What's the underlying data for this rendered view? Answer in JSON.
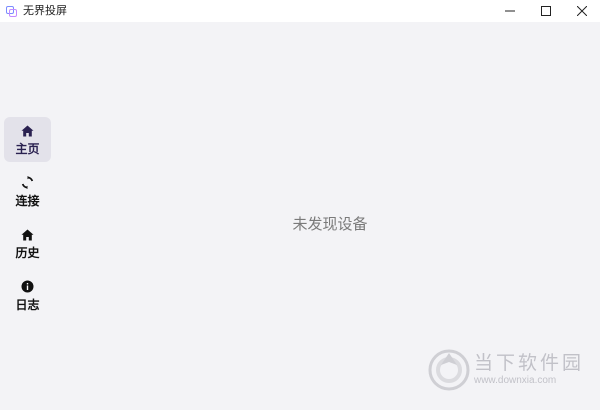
{
  "window": {
    "title": "无界投屏",
    "controls": {
      "minimize_icon": "minimize-icon",
      "maximize_icon": "maximize-icon",
      "close_icon": "close-icon"
    }
  },
  "sidebar": {
    "items": [
      {
        "label": "主页",
        "icon": "home-icon",
        "active": true
      },
      {
        "label": "连接",
        "icon": "sync-icon",
        "active": false
      },
      {
        "label": "历史",
        "icon": "home-icon",
        "active": false
      },
      {
        "label": "日志",
        "icon": "info-icon",
        "active": false
      }
    ]
  },
  "main": {
    "empty_message": "未发现设备"
  },
  "watermark": {
    "name": "当下软件园",
    "url": "www.downxia.com"
  },
  "colors": {
    "background": "#f3f3f6",
    "active_item_bg": "#e3e2ea",
    "active_accent": "#2a2150"
  }
}
